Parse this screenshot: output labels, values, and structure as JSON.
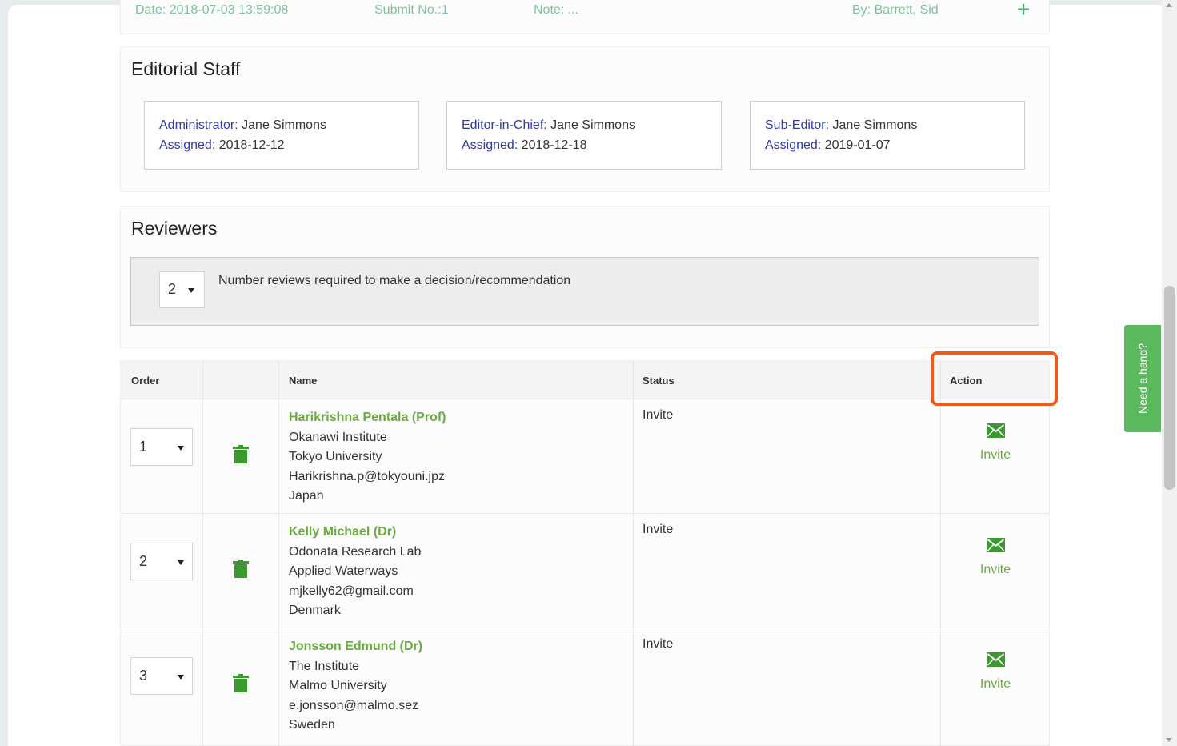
{
  "submission": {
    "date": "Date: 2018-07-03 13:59:08",
    "submit_no": "Submit No.:1",
    "note": "Note: ...",
    "by": "By: Barrett, Sid",
    "add_icon": "+"
  },
  "editorial_staff": {
    "title": "Editorial Staff",
    "assigned_label": "Assigned:",
    "cards": [
      {
        "role": "Administrator:",
        "name": "Jane Simmons",
        "assigned": "2018-12-12"
      },
      {
        "role": "Editor-in-Chief:",
        "name": "Jane Simmons",
        "assigned": "2018-12-18"
      },
      {
        "role": "Sub-Editor:",
        "name": "Jane Simmons",
        "assigned": "2019-01-07"
      }
    ]
  },
  "reviewers": {
    "title": "Reviewers",
    "required_count": "2",
    "required_text": "Number reviews required to make a decision/recommendation",
    "columns": {
      "order": "Order",
      "name": "Name",
      "status": "Status",
      "action": "Action"
    },
    "rows": [
      {
        "order": "1",
        "name": "Harikrishna Pentala (Prof)",
        "lines": [
          "Okanawi Institute",
          "Tokyo University",
          "Harikrishna.p@tokyouni.jpz",
          "Japan"
        ],
        "status": "Invite",
        "action": "Invite"
      },
      {
        "order": "2",
        "name": "Kelly Michael (Dr)",
        "lines": [
          "Odonata Research Lab",
          "Applied Waterways",
          "mjkelly62@gmail.com",
          "Denmark"
        ],
        "status": "Invite",
        "action": "Invite"
      },
      {
        "order": "3",
        "name": "Jonsson Edmund (Dr)",
        "lines": [
          "The Institute",
          "Malmo University",
          "e.jonsson@malmo.sez",
          "Sweden"
        ],
        "status": "Invite",
        "action": "Invite"
      }
    ]
  },
  "help_tab": {
    "label": "Need a hand?"
  },
  "icons": {
    "add": "plus-icon",
    "delete": "trash-icon",
    "invite": "envelope-icon",
    "dropdown": "caret-down-icon"
  },
  "colors": {
    "accent_green": "#6aab3f",
    "label_blue": "#2f3aa8",
    "highlight": "#ef5a1d",
    "help_tab": "#5cb85c"
  }
}
